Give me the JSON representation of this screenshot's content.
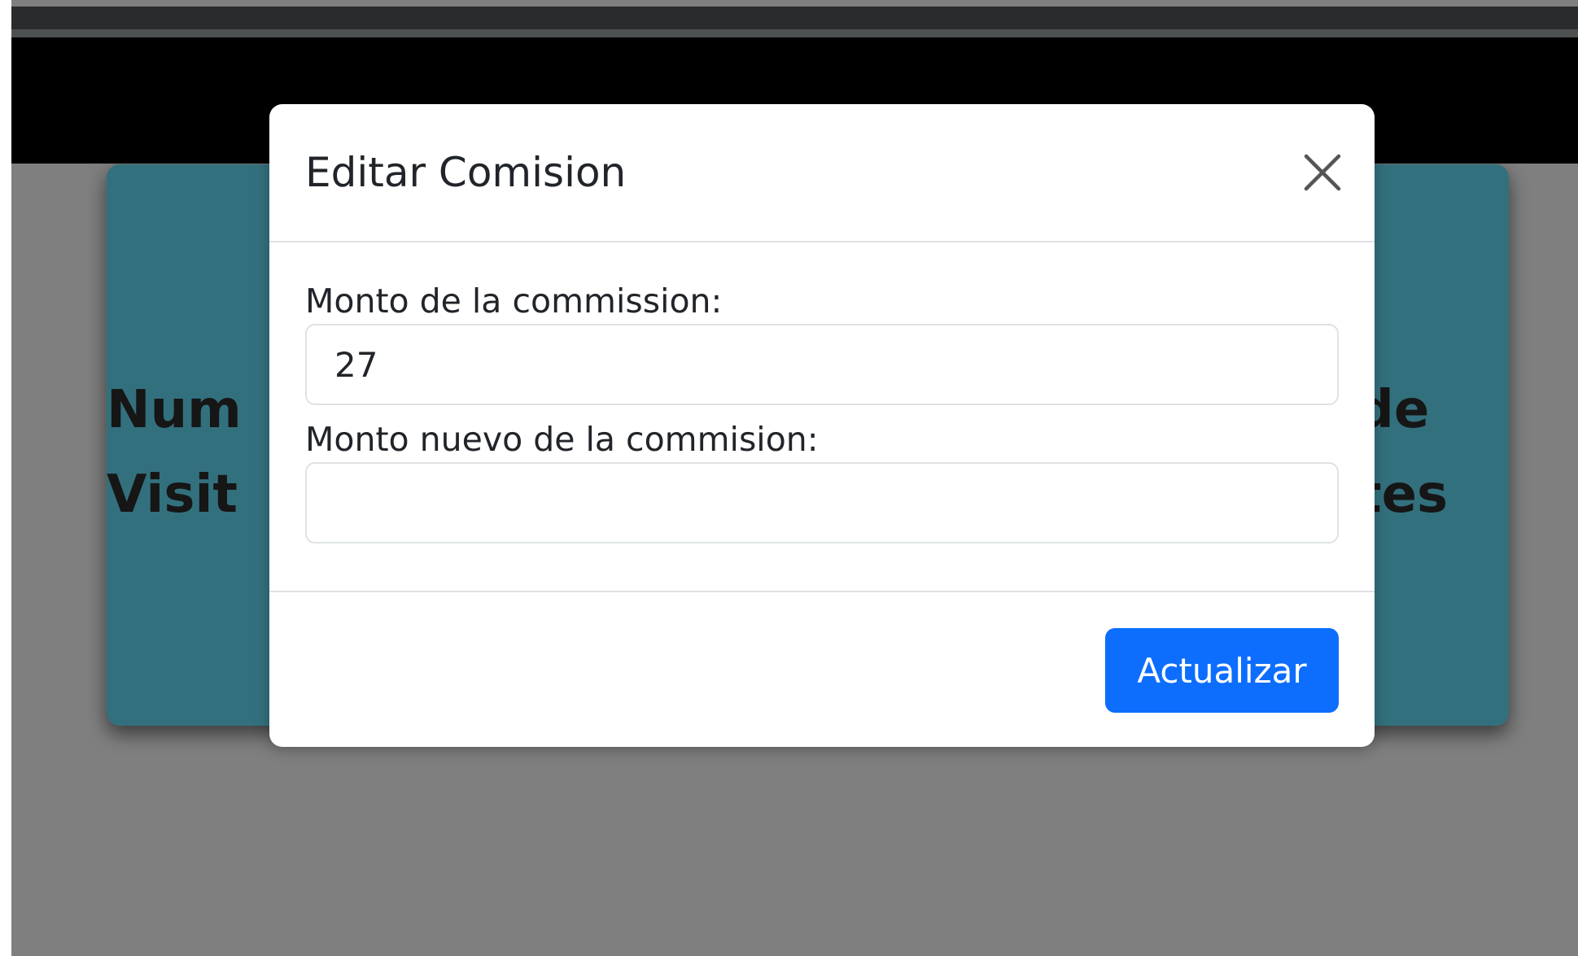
{
  "background_card": {
    "text_left_line1": "Num",
    "text_left_line2": "Visit",
    "text_right_line1": "de",
    "text_right_line2": "tes"
  },
  "modal": {
    "title": "Editar Comision",
    "close_icon": "close-icon",
    "fields": [
      {
        "label": "Monto de la commission:",
        "value": "27",
        "placeholder": ""
      },
      {
        "label": "Monto nuevo de la commision:",
        "value": "",
        "placeholder": ""
      }
    ],
    "submit_label": "Actualizar"
  },
  "colors": {
    "overlay_gray": "#7f7f7f",
    "card_teal": "#33707d",
    "primary_blue": "#0d6efd",
    "nav_black": "#000000"
  }
}
